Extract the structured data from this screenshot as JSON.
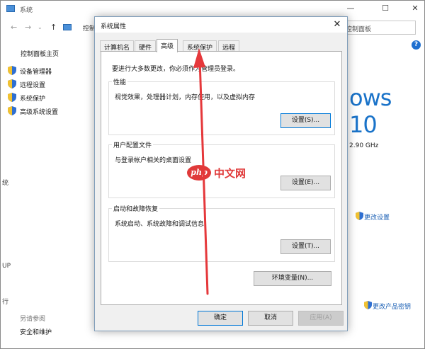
{
  "background_window": {
    "title": "系统",
    "address_text": "控制",
    "search_text": "控制面板",
    "sidebar": {
      "home": "控制面板主页",
      "items": [
        {
          "label": "设备管理器",
          "icon": "shield-icon"
        },
        {
          "label": "远程设置",
          "icon": "shield-icon"
        },
        {
          "label": "系统保护",
          "icon": "shield-icon"
        },
        {
          "label": "高级系统设置",
          "icon": "shield-icon"
        }
      ],
      "see_also": "另请参阅",
      "security": "安全和维护"
    },
    "brand_text": "ows 10",
    "cpu_speed": "2.90 GHz",
    "change_settings": "更改设置",
    "change_product_key": "更改产品密钥",
    "left_edge_chars": [
      "统",
      "UP",
      "行"
    ]
  },
  "dialog": {
    "title": "系统属性",
    "tabs": [
      {
        "label": "计算机名"
      },
      {
        "label": "硬件"
      },
      {
        "label": "高级"
      },
      {
        "label": "系统保护"
      },
      {
        "label": "远程"
      }
    ],
    "active_tab": "高级",
    "admin_note": "要进行大多数更改，你必须作为管理员登录。",
    "groups": [
      {
        "title": "性能",
        "description": "视觉效果，处理器计划，内存使用，以及虚拟内存",
        "button": "设置(S)..."
      },
      {
        "title": "用户配置文件",
        "description": "与登录帐户相关的桌面设置",
        "button": "设置(E)..."
      },
      {
        "title": "启动和故障恢复",
        "description": "系统启动、系统故障和调试信息",
        "button": "设置(T)..."
      }
    ],
    "env_button": "环境变量(N)...",
    "ok_button": "确定",
    "cancel_button": "取消",
    "apply_button": "应用(A)"
  },
  "watermark": {
    "badge": "php",
    "text": "中文网"
  },
  "colors": {
    "accent": "#0078d7",
    "link": "#1a5fb4",
    "arrow": "#e5383b",
    "brand_blue": "#1a73c9"
  }
}
